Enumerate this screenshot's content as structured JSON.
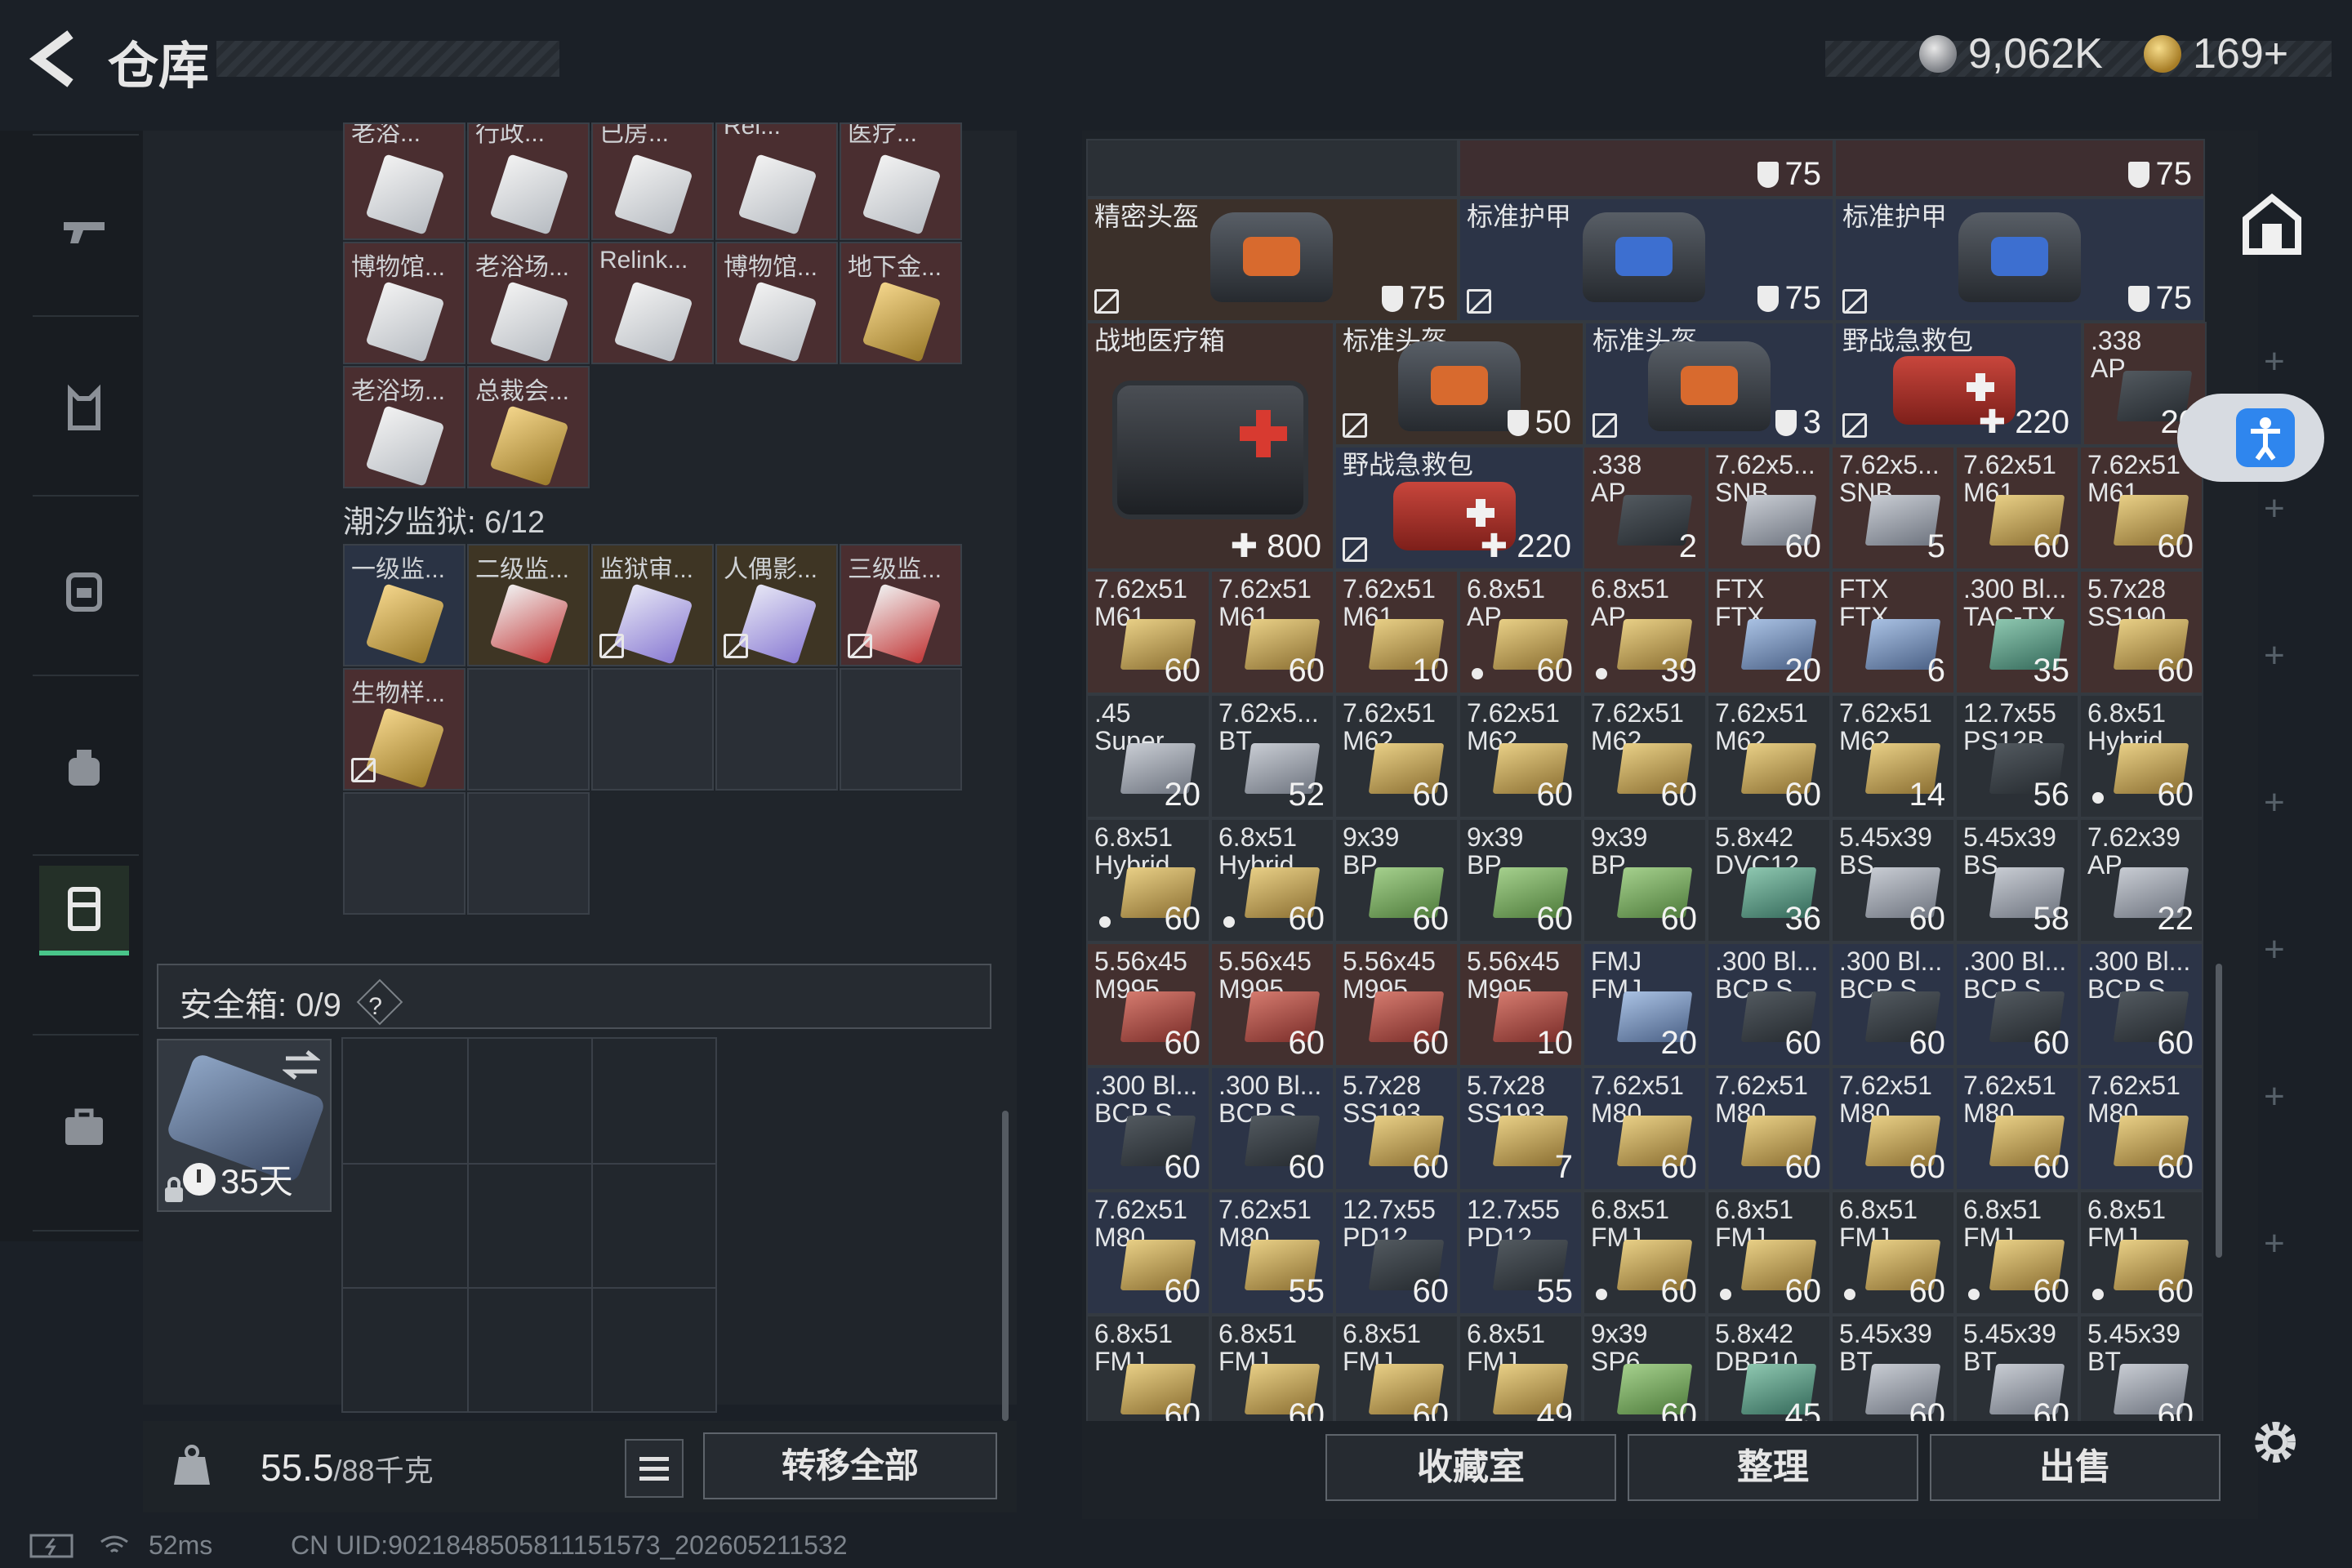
{
  "header": {
    "title": "仓库",
    "currency_silver": "9,062K",
    "currency_gold": "169+"
  },
  "left_containers": {
    "row0": [
      "老浴...",
      "行政...",
      "已房...",
      "Rel...",
      "医疗..."
    ],
    "row1": [
      "博物馆...",
      "老浴场...",
      "Relink...",
      "博物馆...",
      "地下金..."
    ],
    "row2": [
      "老浴场...",
      "总裁会..."
    ],
    "section2_title": "潮汐监狱: 6/12",
    "row3": [
      "一级监...",
      "二级监...",
      "监狱审...",
      "人偶影...",
      "三级监..."
    ],
    "row4": [
      "生物样..."
    ]
  },
  "safebox": {
    "label": "安全箱:",
    "value": "0/9",
    "help": "?",
    "item_days": "35天"
  },
  "bottom_left": {
    "weight_current": "55.5",
    "weight_max": "/88千克",
    "transfer_all": "转移全部"
  },
  "stash_top": {
    "armor_values_top": [
      "75",
      "75"
    ],
    "helmet1_label": "精密头盔",
    "helmet1_value": "75",
    "armor1_label": "标准护甲",
    "armor1_value": "75",
    "armor2_label": "标准护甲",
    "armor2_value": "75",
    "medkit_big_label": "战地医疗箱",
    "medkit_big_value": "800",
    "helmet2_label": "标准头盔",
    "helmet2_value": "50",
    "helmet3_label": "标准头盔",
    "helmet3_value": "3",
    "firstaid1_label": "野战急救包",
    "firstaid1_value": "220",
    "firstaid2_label": "野战急救包",
    "firstaid2_value": "220",
    "ammo338_top": {
      "l1": ".338",
      "l2": "AP",
      "count": "20"
    }
  },
  "ammo_rows": [
    [
      {
        "l1": ".338",
        "l2": "AP",
        "count": "2",
        "c": "ammo-dark",
        "bg": "red",
        "dot": false
      },
      {
        "l1": "7.62x5...",
        "l2": "SNB",
        "count": "60",
        "c": "ammo-gray",
        "bg": "red",
        "dot": false
      },
      {
        "l1": "7.62x5...",
        "l2": "SNB",
        "count": "5",
        "c": "ammo-gray",
        "bg": "red",
        "dot": false
      },
      {
        "l1": "7.62x51",
        "l2": "M61",
        "count": "60",
        "c": "ammo-gold",
        "bg": "red",
        "dot": false
      },
      {
        "l1": "7.62x51",
        "l2": "M61",
        "count": "60",
        "c": "ammo-gold",
        "bg": "red",
        "dot": false
      }
    ],
    [
      {
        "l1": "7.62x51",
        "l2": "M61",
        "count": "60",
        "c": "ammo-gold",
        "bg": "red",
        "dot": false
      },
      {
        "l1": "7.62x51",
        "l2": "M61",
        "count": "60",
        "c": "ammo-gold",
        "bg": "red",
        "dot": false
      },
      {
        "l1": "7.62x51",
        "l2": "M61",
        "count": "10",
        "c": "ammo-gold",
        "bg": "red",
        "dot": false
      },
      {
        "l1": "6.8x51",
        "l2": "AP",
        "count": "60",
        "c": "ammo-gold",
        "bg": "red",
        "dot": true
      },
      {
        "l1": "6.8x51",
        "l2": "AP",
        "count": "39",
        "c": "ammo-gold",
        "bg": "red",
        "dot": true
      },
      {
        "l1": "FTX",
        "l2": "FTX",
        "count": "20",
        "c": "ammo-blue",
        "bg": "red",
        "dot": false
      },
      {
        "l1": "FTX",
        "l2": "FTX",
        "count": "6",
        "c": "ammo-blue",
        "bg": "red",
        "dot": false
      },
      {
        "l1": ".300 Bl...",
        "l2": "TAC-TX",
        "count": "35",
        "c": "ammo-teal",
        "bg": "red",
        "dot": false
      },
      {
        "l1": "5.7x28",
        "l2": "SS190",
        "count": "60",
        "c": "ammo-gold",
        "bg": "red",
        "dot": false
      }
    ],
    [
      {
        "l1": ".45",
        "l2": "Super",
        "count": "20",
        "c": "ammo-gray",
        "bg": "dark",
        "dot": false
      },
      {
        "l1": "7.62x5...",
        "l2": "BT",
        "count": "52",
        "c": "ammo-gray",
        "bg": "dark",
        "dot": false
      },
      {
        "l1": "7.62x51",
        "l2": "M62",
        "count": "60",
        "c": "ammo-gold",
        "bg": "dark",
        "dot": false
      },
      {
        "l1": "7.62x51",
        "l2": "M62",
        "count": "60",
        "c": "ammo-gold",
        "bg": "dark",
        "dot": false
      },
      {
        "l1": "7.62x51",
        "l2": "M62",
        "count": "60",
        "c": "ammo-gold",
        "bg": "dark",
        "dot": false
      },
      {
        "l1": "7.62x51",
        "l2": "M62",
        "count": "60",
        "c": "ammo-gold",
        "bg": "dark",
        "dot": false
      },
      {
        "l1": "7.62x51",
        "l2": "M62",
        "count": "14",
        "c": "ammo-gold",
        "bg": "dark",
        "dot": false
      },
      {
        "l1": "12.7x55",
        "l2": "PS12B",
        "count": "56",
        "c": "ammo-dark",
        "bg": "dark",
        "dot": false
      },
      {
        "l1": "6.8x51",
        "l2": "Hybrid",
        "count": "60",
        "c": "ammo-gold",
        "bg": "dark",
        "dot": true
      }
    ],
    [
      {
        "l1": "6.8x51",
        "l2": "Hybrid",
        "count": "60",
        "c": "ammo-gold",
        "bg": "dark",
        "dot": true
      },
      {
        "l1": "6.8x51",
        "l2": "Hybrid",
        "count": "60",
        "c": "ammo-gold",
        "bg": "dark",
        "dot": true
      },
      {
        "l1": "9x39",
        "l2": "BP",
        "count": "60",
        "c": "ammo-green",
        "bg": "dark",
        "dot": false
      },
      {
        "l1": "9x39",
        "l2": "BP",
        "count": "60",
        "c": "ammo-green",
        "bg": "dark",
        "dot": false
      },
      {
        "l1": "9x39",
        "l2": "BP",
        "count": "60",
        "c": "ammo-green",
        "bg": "dark",
        "dot": false
      },
      {
        "l1": "5.8x42",
        "l2": "DVC12",
        "count": "36",
        "c": "ammo-teal",
        "bg": "dark",
        "dot": false
      },
      {
        "l1": "5.45x39",
        "l2": "BS",
        "count": "60",
        "c": "ammo-gray",
        "bg": "dark",
        "dot": false
      },
      {
        "l1": "5.45x39",
        "l2": "BS",
        "count": "58",
        "c": "ammo-gray",
        "bg": "dark",
        "dot": false
      },
      {
        "l1": "7.62x39",
        "l2": "AP",
        "count": "22",
        "c": "ammo-gray",
        "bg": "dark",
        "dot": false
      }
    ],
    [
      {
        "l1": "5.56x45",
        "l2": "M995",
        "count": "60",
        "c": "ammo-red",
        "bg": "red",
        "dot": false
      },
      {
        "l1": "5.56x45",
        "l2": "M995",
        "count": "60",
        "c": "ammo-red",
        "bg": "red",
        "dot": false
      },
      {
        "l1": "5.56x45",
        "l2": "M995",
        "count": "60",
        "c": "ammo-red",
        "bg": "red",
        "dot": false
      },
      {
        "l1": "5.56x45",
        "l2": "M995",
        "count": "10",
        "c": "ammo-red",
        "bg": "red",
        "dot": false
      },
      {
        "l1": "FMJ",
        "l2": "FMJ",
        "count": "20",
        "c": "ammo-blue",
        "bg": "blue",
        "dot": false
      },
      {
        "l1": ".300 Bl...",
        "l2": "BCP S...",
        "count": "60",
        "c": "ammo-dark",
        "bg": "blue",
        "dot": false
      },
      {
        "l1": ".300 Bl...",
        "l2": "BCP S...",
        "count": "60",
        "c": "ammo-dark",
        "bg": "blue",
        "dot": false
      },
      {
        "l1": ".300 Bl...",
        "l2": "BCP S...",
        "count": "60",
        "c": "ammo-dark",
        "bg": "blue",
        "dot": false
      },
      {
        "l1": ".300 Bl...",
        "l2": "BCP S...",
        "count": "60",
        "c": "ammo-dark",
        "bg": "blue",
        "dot": false
      }
    ],
    [
      {
        "l1": ".300 Bl...",
        "l2": "BCP S...",
        "count": "60",
        "c": "ammo-dark",
        "bg": "blue",
        "dot": false
      },
      {
        "l1": ".300 Bl...",
        "l2": "BCP S...",
        "count": "60",
        "c": "ammo-dark",
        "bg": "blue",
        "dot": false
      },
      {
        "l1": "5.7x28",
        "l2": "SS193",
        "count": "60",
        "c": "ammo-gold",
        "bg": "blue",
        "dot": false
      },
      {
        "l1": "5.7x28",
        "l2": "SS193",
        "count": "7",
        "c": "ammo-gold",
        "bg": "blue",
        "dot": false
      },
      {
        "l1": "7.62x51",
        "l2": "M80",
        "count": "60",
        "c": "ammo-gold",
        "bg": "blue",
        "dot": false
      },
      {
        "l1": "7.62x51",
        "l2": "M80",
        "count": "60",
        "c": "ammo-gold",
        "bg": "blue",
        "dot": false
      },
      {
        "l1": "7.62x51",
        "l2": "M80",
        "count": "60",
        "c": "ammo-gold",
        "bg": "blue",
        "dot": false
      },
      {
        "l1": "7.62x51",
        "l2": "M80",
        "count": "60",
        "c": "ammo-gold",
        "bg": "blue",
        "dot": false
      },
      {
        "l1": "7.62x51",
        "l2": "M80",
        "count": "60",
        "c": "ammo-gold",
        "bg": "blue",
        "dot": false
      }
    ],
    [
      {
        "l1": "7.62x51",
        "l2": "M80",
        "count": "60",
        "c": "ammo-gold",
        "bg": "blue",
        "dot": false
      },
      {
        "l1": "7.62x51",
        "l2": "M80",
        "count": "55",
        "c": "ammo-gold",
        "bg": "blue",
        "dot": false
      },
      {
        "l1": "12.7x55",
        "l2": "PD12...",
        "count": "60",
        "c": "ammo-dark",
        "bg": "blue",
        "dot": false
      },
      {
        "l1": "12.7x55",
        "l2": "PD12...",
        "count": "55",
        "c": "ammo-dark",
        "bg": "blue",
        "dot": false
      },
      {
        "l1": "6.8x51",
        "l2": "FMJ",
        "count": "60",
        "c": "ammo-gold",
        "bg": "dark",
        "dot": true
      },
      {
        "l1": "6.8x51",
        "l2": "FMJ",
        "count": "60",
        "c": "ammo-gold",
        "bg": "dark",
        "dot": true
      },
      {
        "l1": "6.8x51",
        "l2": "FMJ",
        "count": "60",
        "c": "ammo-gold",
        "bg": "dark",
        "dot": true
      },
      {
        "l1": "6.8x51",
        "l2": "FMJ",
        "count": "60",
        "c": "ammo-gold",
        "bg": "dark",
        "dot": true
      },
      {
        "l1": "6.8x51",
        "l2": "FMJ",
        "count": "60",
        "c": "ammo-gold",
        "bg": "dark",
        "dot": true
      }
    ],
    [
      {
        "l1": "6.8x51",
        "l2": "FMJ",
        "count": "60",
        "c": "ammo-gold",
        "bg": "dark",
        "dot": false
      },
      {
        "l1": "6.8x51",
        "l2": "FMJ",
        "count": "60",
        "c": "ammo-gold",
        "bg": "dark",
        "dot": false
      },
      {
        "l1": "6.8x51",
        "l2": "FMJ",
        "count": "60",
        "c": "ammo-gold",
        "bg": "dark",
        "dot": false
      },
      {
        "l1": "6.8x51",
        "l2": "FMJ",
        "count": "49",
        "c": "ammo-gold",
        "bg": "dark",
        "dot": false
      },
      {
        "l1": "9x39",
        "l2": "SP6",
        "count": "60",
        "c": "ammo-green",
        "bg": "dark",
        "dot": false
      },
      {
        "l1": "5.8x42",
        "l2": "DBP10",
        "count": "45",
        "c": "ammo-teal",
        "bg": "dark",
        "dot": false
      },
      {
        "l1": "5.45x39",
        "l2": "BT",
        "count": "60",
        "c": "ammo-gray",
        "bg": "dark",
        "dot": false
      },
      {
        "l1": "5.45x39",
        "l2": "BT",
        "count": "60",
        "c": "ammo-gray",
        "bg": "dark",
        "dot": false
      },
      {
        "l1": "5.45x39",
        "l2": "BT",
        "count": "60",
        "c": "ammo-gray",
        "bg": "dark",
        "dot": false
      }
    ]
  ],
  "bottom_right": {
    "collection": "收藏室",
    "sort": "整理",
    "sell": "出售"
  },
  "status": {
    "ping": "52ms",
    "uid": "CN UID:9021848505811151573_202605211532"
  }
}
